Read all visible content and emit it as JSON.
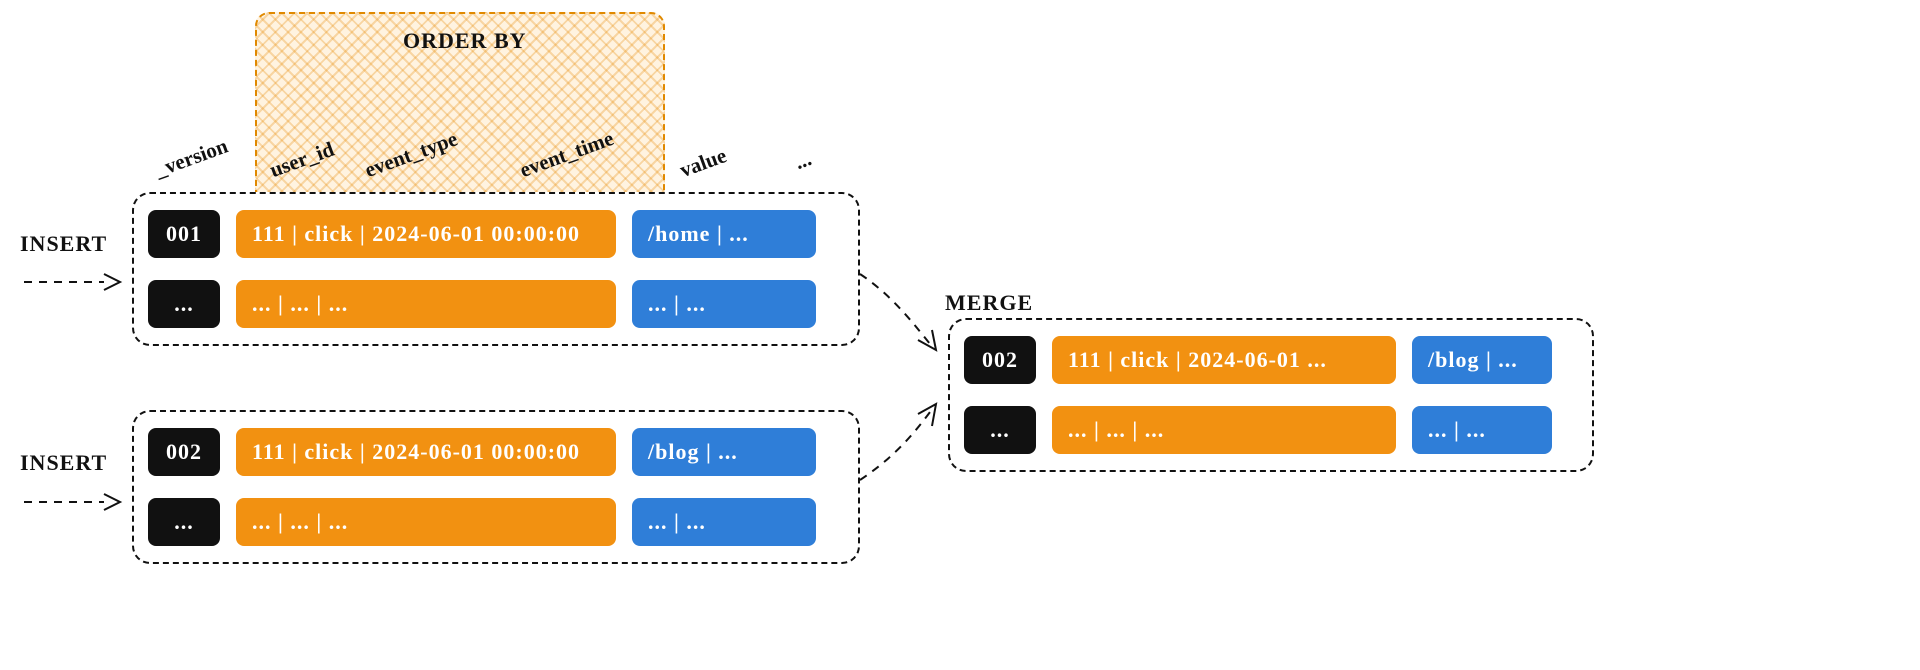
{
  "labels": {
    "orderby": "ORDER BY",
    "insert": "INSERT",
    "merge": "MERGE"
  },
  "columns": {
    "version": "_version",
    "user_id": "user_id",
    "event_type": "event_type",
    "event_time": "event_time",
    "value": "value",
    "rest": "..."
  },
  "colors": {
    "version": "#111111",
    "key": "#f29111",
    "value": "#2f7ed8",
    "highlight_border": "#e08900"
  },
  "insert1": {
    "rows": [
      {
        "version": "001",
        "key": "111  |  click  |  2024-06-01 00:00:00",
        "value": "/home  |  ..."
      },
      {
        "version": "...",
        "key": "...  |  ...     |  ...",
        "value": "...     |  ..."
      }
    ]
  },
  "insert2": {
    "rows": [
      {
        "version": "002",
        "key": "111  |  click  |  2024-06-01 00:00:00",
        "value": "/blog  |  ..."
      },
      {
        "version": "...",
        "key": "...  |  ...     |  ...",
        "value": "...     |  ..."
      }
    ]
  },
  "merge": {
    "rows": [
      {
        "version": "002",
        "key": "111  |  click  |  2024-06-01 ...",
        "value": "/blog  |  ..."
      },
      {
        "version": "...",
        "key": "...  |  ...     |  ...",
        "value": "...     |  ..."
      }
    ]
  }
}
